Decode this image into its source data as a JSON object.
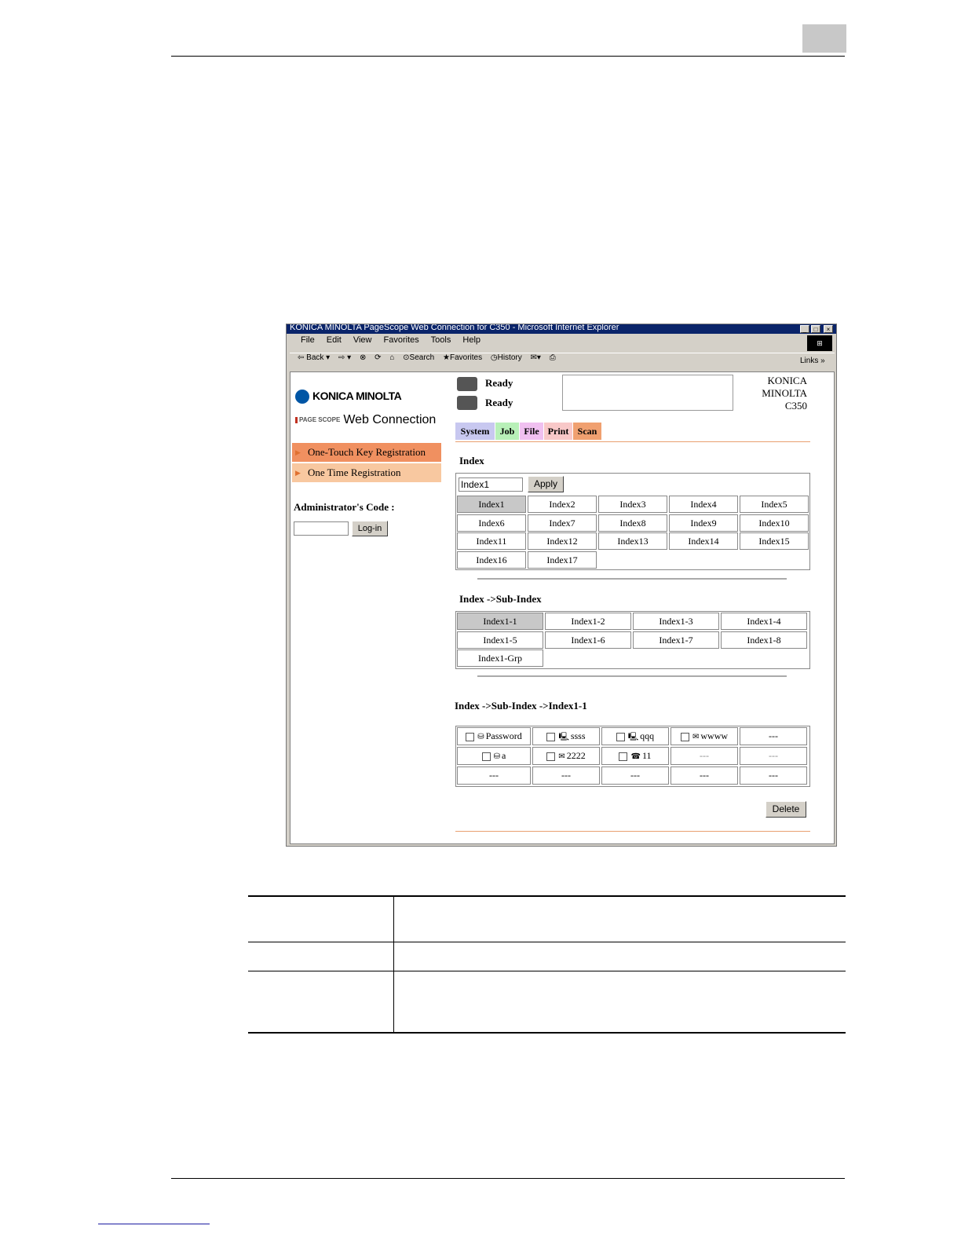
{
  "browser": {
    "title": "KONICA MINOLTA PageScope Web Connection for C350 - Microsoft Internet Explorer",
    "menu": [
      "File",
      "Edit",
      "View",
      "Favorites",
      "Tools",
      "Help"
    ],
    "toolbar": {
      "back": "Back",
      "search": "Search",
      "favorites": "Favorites",
      "history": "History",
      "links": "Links"
    }
  },
  "sidebar": {
    "brand": "KONICA MINOLTA",
    "product_logo": "Web Connection",
    "product_badge": "PAGE SCOPE",
    "items": [
      {
        "label": "One-Touch Key Registration",
        "active": true
      },
      {
        "label": "One Time Registration",
        "active": false
      }
    ],
    "admin_label": "Administrator's Code :",
    "login_button": "Log-in"
  },
  "header": {
    "status": [
      "Ready",
      "Ready"
    ],
    "model": [
      "KONICA",
      "MINOLTA",
      "C350"
    ],
    "tabs": [
      {
        "label": "System",
        "color": "#c8c8f0"
      },
      {
        "label": "Job",
        "color": "#b8f0b8"
      },
      {
        "label": "File",
        "color": "#f0c0f0"
      },
      {
        "label": "Print",
        "color": "#f8c8c8"
      },
      {
        "label": "Scan",
        "color": "#f0a070"
      }
    ]
  },
  "index": {
    "heading": "Index",
    "input_value": "Index1",
    "apply_button": "Apply",
    "items": [
      "Index1",
      "Index2",
      "Index3",
      "Index4",
      "Index5",
      "Index6",
      "Index7",
      "Index8",
      "Index9",
      "Index10",
      "Index11",
      "Index12",
      "Index13",
      "Index14",
      "Index15",
      "Index16",
      "Index17"
    ],
    "selected": "Index1"
  },
  "subindex": {
    "heading": "Index ->Sub-Index",
    "items": [
      "Index1-1",
      "Index1-2",
      "Index1-3",
      "Index1-4",
      "Index1-5",
      "Index1-6",
      "Index1-7",
      "Index1-8",
      "Index1-Grp"
    ],
    "selected": "Index1-1"
  },
  "entries": {
    "heading": "Index ->Sub-Index ->Index1-1",
    "rows": [
      [
        {
          "label": "Password",
          "icon": "database-icon"
        },
        {
          "label": "ssss",
          "icon": "pc-icon"
        },
        {
          "label": "qqq",
          "icon": "pc-icon"
        },
        {
          "label": "wwww",
          "icon": "mail-icon"
        },
        {
          "label": "---"
        }
      ],
      [
        {
          "label": "a",
          "icon": "database-icon"
        },
        {
          "label": "2222",
          "icon": "mail-icon"
        },
        {
          "label": "11",
          "icon": "fax-icon"
        },
        {
          "label": "---"
        },
        {
          "label": "---"
        }
      ],
      [
        {
          "label": "---"
        },
        {
          "label": "---"
        },
        {
          "label": "---"
        },
        {
          "label": "---"
        },
        {
          "label": "---"
        }
      ]
    ],
    "delete_button": "Delete"
  }
}
